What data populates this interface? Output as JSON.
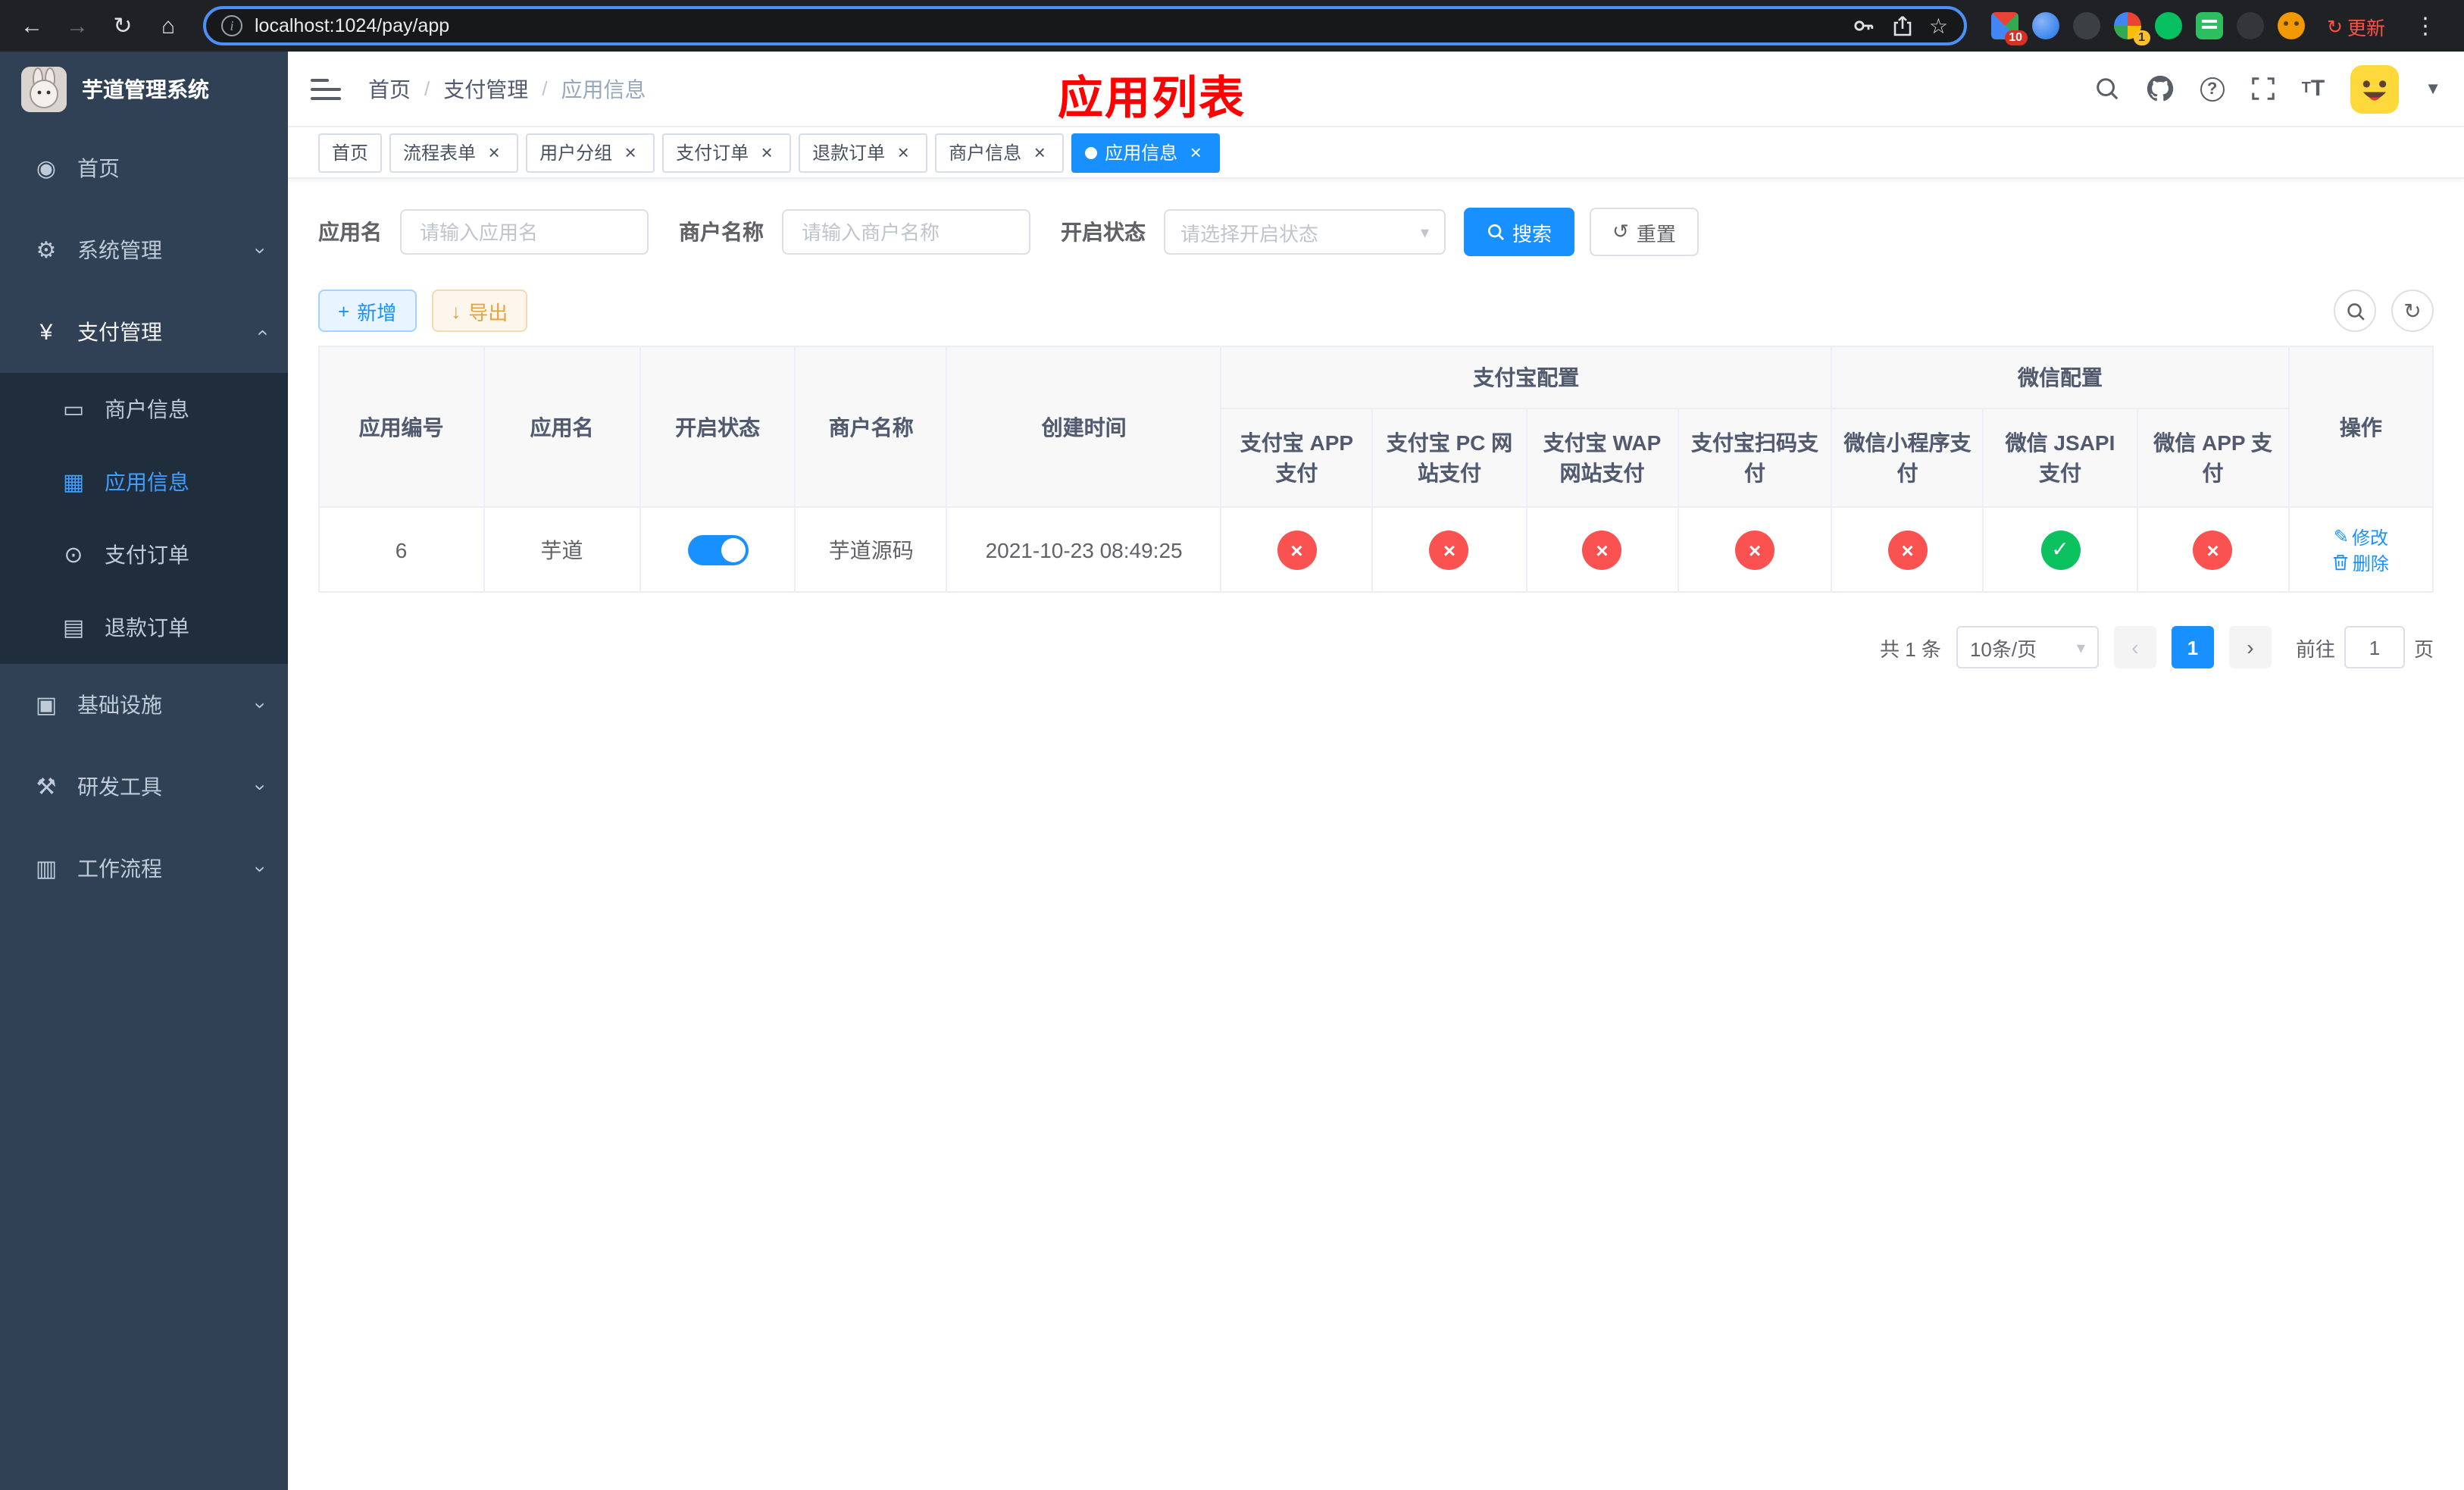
{
  "browser": {
    "url": "localhost:1024/pay/app",
    "update_label": "更新",
    "ext_badge_grid": "10",
    "ext_badge_profile": "1"
  },
  "sidebar": {
    "title": "芋道管理系统",
    "top_items": [
      {
        "label": "首页"
      },
      {
        "label": "系统管理"
      },
      {
        "label": "支付管理"
      }
    ],
    "pay_children": [
      {
        "label": "商户信息"
      },
      {
        "label": "应用信息",
        "active": true
      },
      {
        "label": "支付订单"
      },
      {
        "label": "退款订单"
      }
    ],
    "bottom_items": [
      {
        "label": "基础设施"
      },
      {
        "label": "研发工具"
      },
      {
        "label": "工作流程"
      }
    ]
  },
  "header": {
    "breadcrumb": [
      {
        "label": "首页"
      },
      {
        "label": "支付管理"
      },
      {
        "label": "应用信息"
      }
    ],
    "overlay_title": "应用列表"
  },
  "tabs": [
    {
      "label": "首页",
      "closable": false
    },
    {
      "label": "流程表单",
      "closable": true
    },
    {
      "label": "用户分组",
      "closable": true
    },
    {
      "label": "支付订单",
      "closable": true
    },
    {
      "label": "退款订单",
      "closable": true
    },
    {
      "label": "商户信息",
      "closable": true
    },
    {
      "label": "应用信息",
      "closable": true,
      "active": true
    }
  ],
  "filters": {
    "app_name_label": "应用名",
    "app_name_placeholder": "请输入应用名",
    "merchant_label": "商户名称",
    "merchant_placeholder": "请输入商户名称",
    "status_label": "开启状态",
    "status_placeholder": "请选择开启状态",
    "search_label": "搜索",
    "reset_label": "重置"
  },
  "toolbar": {
    "add_label": "新增",
    "export_label": "导出"
  },
  "table": {
    "col_app_id": "应用编号",
    "col_app_name": "应用名",
    "col_status": "开启状态",
    "col_merchant": "商户名称",
    "col_created": "创建时间",
    "col_alipay_group": "支付宝配置",
    "col_wechat_group": "微信配置",
    "col_alipay_app": "支付宝 APP 支付",
    "col_alipay_pc": "支付宝 PC 网站支付",
    "col_alipay_wap": "支付宝 WAP 网站支付",
    "col_alipay_qr": "支付宝扫码支付",
    "col_wx_mini": "微信小程序支付",
    "col_wx_jsapi": "微信 JSAPI 支付",
    "col_wx_app": "微信 APP 支付",
    "col_actions": "操作",
    "row": {
      "app_id": "6",
      "app_name": "芋道",
      "status_on": true,
      "merchant": "芋道源码",
      "created": "2021-10-23 08:49:25",
      "payment_statuses": [
        "disabled",
        "disabled",
        "disabled",
        "disabled",
        "disabled",
        "enabled",
        "disabled"
      ],
      "edit_label": "修改",
      "delete_label": "删除"
    }
  },
  "pagination": {
    "total_text": "共 1 条",
    "page_size": "10条/页",
    "current_page": "1",
    "goto_label": "前往",
    "goto_value": "1",
    "goto_suffix": "页"
  },
  "colors": {
    "primary": "#1890ff",
    "sidebar_active": "#409eff",
    "success": "#0bc160",
    "danger": "#fa5151",
    "warning": "#e6a23c",
    "overlay_title": "#ff0000",
    "sidebar_bg": "#304156",
    "submenu_bg": "#1f2d3d"
  },
  "icons": {
    "close": "×",
    "check": "✓",
    "cross": "×",
    "caret_down": "▾",
    "chevron": "›",
    "plus": "+",
    "download": "↓",
    "refresh": "↻",
    "reset": "↺",
    "edit": "✎",
    "menu_dots": "⋮",
    "back": "←",
    "forward": "→",
    "home": "⌂",
    "star": "☆"
  }
}
